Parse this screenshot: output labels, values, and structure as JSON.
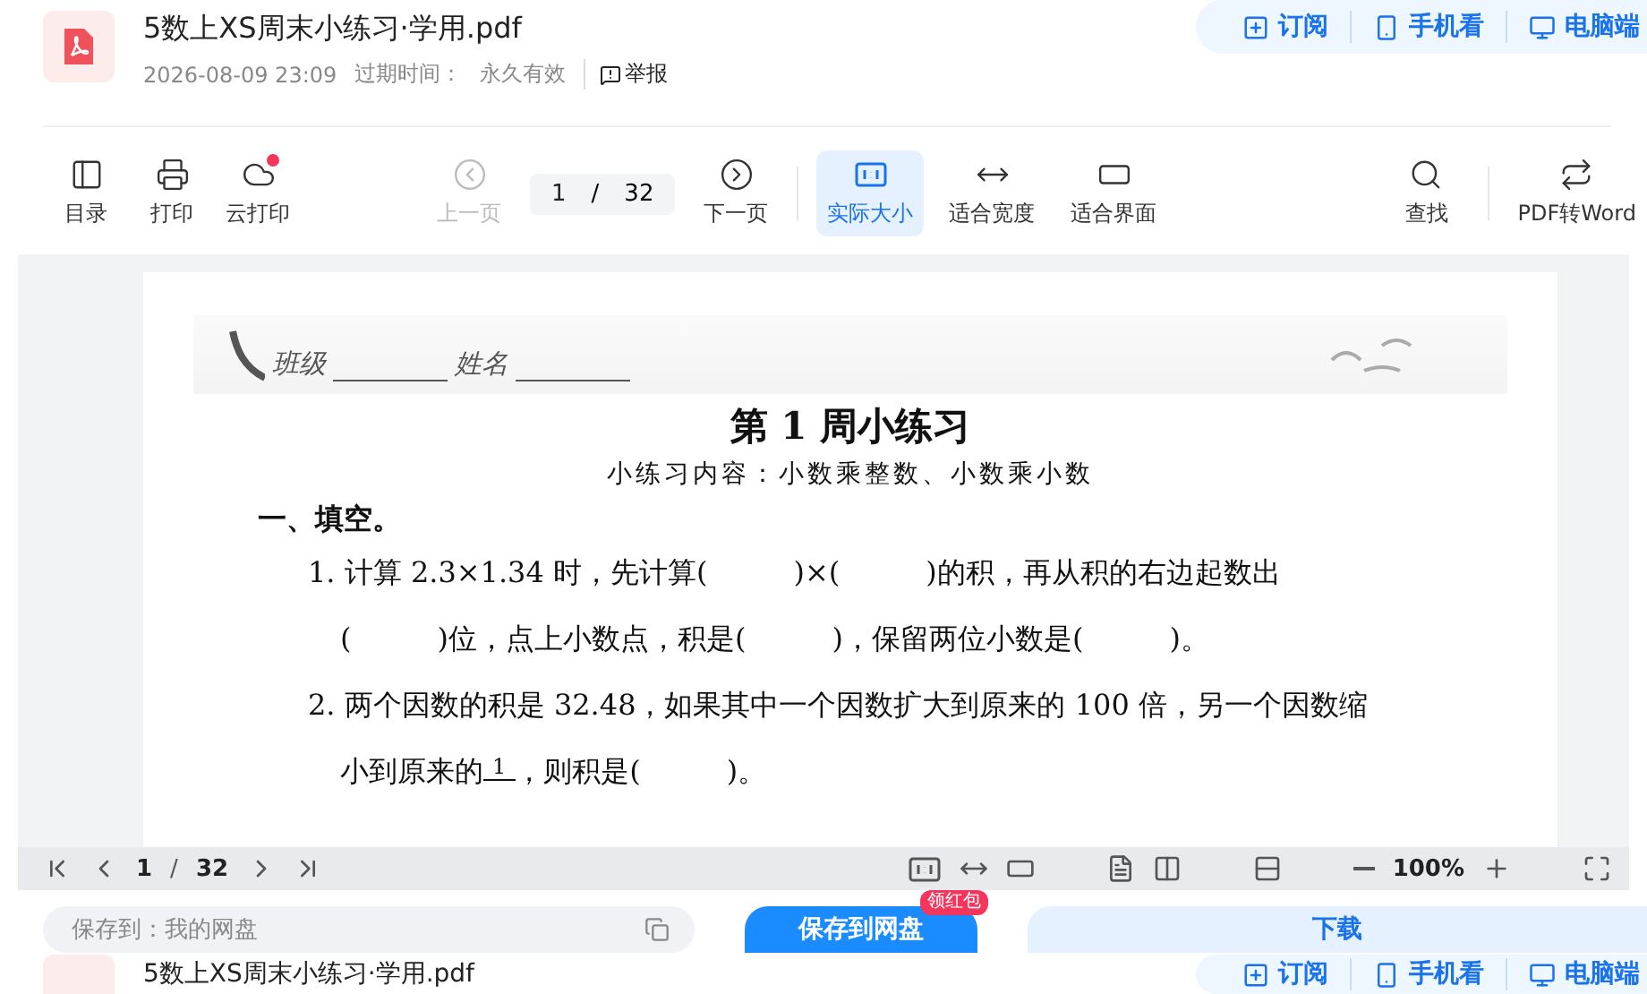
{
  "header": {
    "file_name": "5数上XS周末小练习·学用.pdf",
    "date": "2026-08-09 23:09",
    "expiry_label": "过期时间：",
    "expiry_value": "永久有效",
    "report": "举报"
  },
  "header_actions": [
    {
      "kind": "subscribe",
      "label": "订阅"
    },
    {
      "kind": "phone",
      "label": "手机看"
    },
    {
      "kind": "desktop",
      "label": "电脑端"
    }
  ],
  "toolbar": {
    "left": [
      {
        "kind": "toc",
        "label": "目录",
        "badge": false
      },
      {
        "kind": "print",
        "label": "打印",
        "badge": false
      },
      {
        "kind": "cloud",
        "label": "云打印",
        "badge": true
      }
    ],
    "prev": {
      "label": "上一页",
      "disabled": true
    },
    "page": "1",
    "separator": "/",
    "total": "32",
    "next": {
      "label": "下一页",
      "disabled": false
    },
    "views": [
      {
        "kind": "actual",
        "label": "实际大小",
        "selected": true
      },
      {
        "kind": "width",
        "label": "适合宽度",
        "selected": false
      },
      {
        "kind": "fit",
        "label": "适合界面",
        "selected": false
      }
    ],
    "right": [
      {
        "kind": "search",
        "label": "查找"
      },
      {
        "kind": "convert",
        "label": "PDF转Word"
      }
    ]
  },
  "document": {
    "class_label": "班级",
    "name_label": "姓名",
    "title": "第 1 周小练习",
    "subtitle": "小练习内容：小数乘整数、小数乘小数",
    "section": "一、填空。",
    "lines": [
      {
        "kind": "item",
        "text": "1. 计算 2.3×1.34 时，先计算(　　　)×(　　　)的积，再从积的右边起数出"
      },
      {
        "kind": "cont",
        "text": "(　　　)位，点上小数点，积是(　　　)，保留两位小数是(　　　)。"
      },
      {
        "kind": "item",
        "text": "2. 两个因数的积是 32.48，如果其中一个因数扩大到原来的 100 倍，另一个因数缩"
      },
      {
        "kind": "fraction",
        "before": "小到原来的",
        "numerator": "1",
        "after": "，则积是(　　　)。"
      }
    ]
  },
  "viewer_bar": {
    "page": "1",
    "separator": "/",
    "total": "32",
    "zoom": "100%"
  },
  "save_bar": {
    "target": "保存到：我的网盘",
    "save_button": "保存到网盘",
    "badge": "领红包",
    "download": "下载"
  },
  "sticky_header": {
    "file_name": "5数上XS周末小练习·学用.pdf",
    "actions": [
      {
        "kind": "subscribe",
        "label": "订阅"
      },
      {
        "kind": "phone",
        "label": "手机看"
      },
      {
        "kind": "desktop",
        "label": "电脑端"
      }
    ]
  }
}
